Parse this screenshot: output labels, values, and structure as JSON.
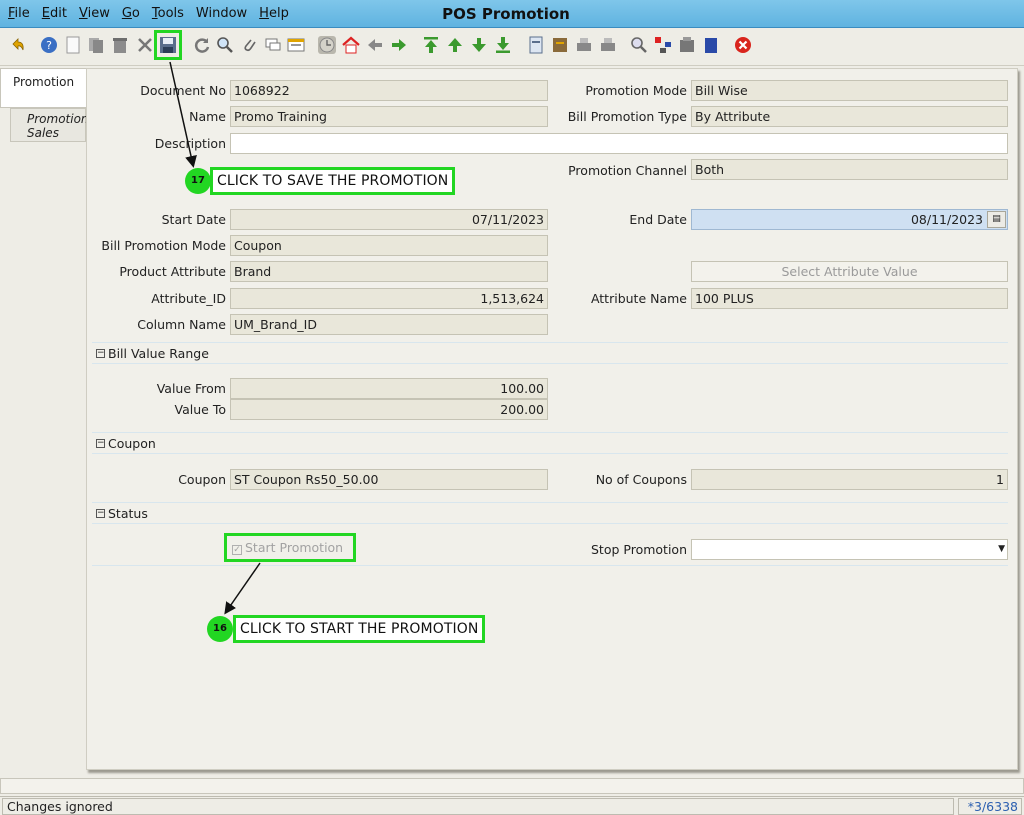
{
  "menu": [
    {
      "key": "F",
      "rest": "ile"
    },
    {
      "key": "E",
      "rest": "dit"
    },
    {
      "key": "V",
      "rest": "iew"
    },
    {
      "key": "G",
      "rest": "o"
    },
    {
      "key": "T",
      "rest": "ools"
    },
    {
      "key": "",
      "rest": "Window"
    },
    {
      "key": "H",
      "rest": "elp"
    }
  ],
  "window_title": "POS Promotion",
  "tabs": {
    "promotion": "Promotion",
    "promotion_sales": "Promotion Sales"
  },
  "fields": {
    "document_no": {
      "label": "Document No",
      "value": "1068922"
    },
    "name": {
      "label": "Name",
      "value": "Promo Training"
    },
    "description": {
      "label": "Description",
      "value": ""
    },
    "promotion_mode": {
      "label": "Promotion Mode",
      "value": "Bill Wise"
    },
    "bill_promotion_type": {
      "label": "Bill Promotion Type",
      "value": "By Attribute"
    },
    "promotion_channel": {
      "label": "Promotion Channel",
      "value": "Both"
    },
    "start_date": {
      "label": "Start Date",
      "value": "07/11/2023"
    },
    "end_date": {
      "label": "End Date",
      "value": "08/11/2023"
    },
    "bill_promotion_mode": {
      "label": "Bill Promotion Mode",
      "value": "Coupon"
    },
    "product_attribute": {
      "label": "Product Attribute",
      "value": "Brand"
    },
    "select_attribute_value": {
      "placeholder": "Select Attribute Value"
    },
    "attribute_id": {
      "label": "Attribute_ID",
      "value": "1,513,624"
    },
    "attribute_name": {
      "label": "Attribute Name",
      "value": "100 PLUS"
    },
    "column_name": {
      "label": "Column Name",
      "value": "UM_Brand_ID"
    }
  },
  "sections": {
    "bill_value_range": {
      "title": "Bill Value Range",
      "value_from_label": "Value From",
      "value_from": "100.00",
      "value_to_label": "Value To",
      "value_to": "200.00"
    },
    "coupon": {
      "title": "Coupon",
      "coupon_label": "Coupon",
      "coupon_value": "ST Coupon Rs50_50.00",
      "no_of_coupons_label": "No of Coupons",
      "no_of_coupons": "1"
    },
    "status": {
      "title": "Status",
      "start_promotion_label": "Start Promotion",
      "start_promotion_checked": true,
      "stop_promotion_label": "Stop Promotion",
      "stop_promotion_value": ""
    }
  },
  "annotations": {
    "step17": {
      "number": "17",
      "text": "CLICK TO SAVE THE PROMOTION"
    },
    "step16": {
      "number": "16",
      "text": "CLICK TO START THE PROMOTION"
    }
  },
  "statusbar": {
    "message": "Changes ignored",
    "record": "*3/6338"
  },
  "colors": {
    "title_bar": "#6ab9e4",
    "highlight": "#22d622",
    "field_bg": "#e9e7da",
    "date_focus": "#cfe0f2",
    "close_red": "#d9251d"
  },
  "toolbar_icons": [
    "undo-icon",
    "help-icon",
    "new-record-icon",
    "copy-record-icon",
    "delete-icon",
    "delete-selection-icon",
    "save-icon",
    "refresh-icon",
    "find-icon",
    "attachment-icon",
    "chat-icon",
    "grid-toggle-icon",
    "history-icon",
    "home-icon",
    "previous-icon",
    "next-icon",
    "first-record-icon",
    "previous-record-icon",
    "next-record-icon",
    "last-record-icon",
    "report-icon",
    "archive-icon",
    "print-preview-icon",
    "print-icon",
    "zoom-across-icon",
    "workflow-icon",
    "product-info-icon",
    "request-icon",
    "close-window-icon"
  ]
}
